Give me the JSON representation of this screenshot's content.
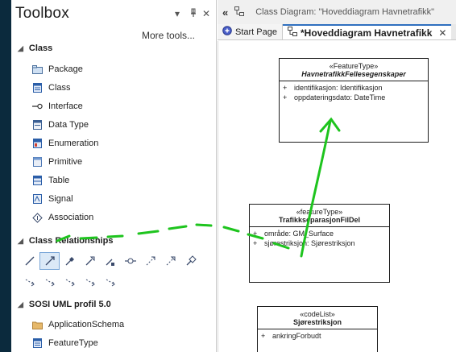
{
  "toolbox": {
    "title": "Toolbox",
    "pin_glyph": "▾",
    "dock_glyph": "ᵽ",
    "close_glyph": "✕",
    "more_tools": "More tools...",
    "sections": [
      {
        "label": "Class",
        "items": [
          {
            "label": "Package",
            "icon": "package-icon"
          },
          {
            "label": "Class",
            "icon": "class-icon"
          },
          {
            "label": "Interface",
            "icon": "interface-icon"
          },
          {
            "label": "Data Type",
            "icon": "data-type-icon"
          },
          {
            "label": "Enumeration",
            "icon": "enumeration-icon"
          },
          {
            "label": "Primitive",
            "icon": "primitive-icon"
          },
          {
            "label": "Table",
            "icon": "table-icon"
          },
          {
            "label": "Signal",
            "icon": "signal-icon"
          },
          {
            "label": "Association",
            "icon": "association-icon"
          }
        ]
      },
      {
        "label": "Class Relationships"
      },
      {
        "label": "SOSI UML profil 5.0",
        "items": [
          {
            "label": "ApplicationSchema",
            "icon": "folder-icon"
          },
          {
            "label": "FeatureType",
            "icon": "feature-type-icon"
          }
        ]
      }
    ]
  },
  "editor": {
    "path_text": "Class Diagram: \"Hoveddiagram Havnetrafikk\"",
    "tabs": [
      {
        "label": "Start Page"
      },
      {
        "label": "*Hoveddiagram Havnetrafikk"
      }
    ],
    "close_glyph": "✕"
  },
  "diagram": {
    "classes": [
      {
        "stereotype": "«FeatureType»",
        "name": "HavnetrafikkFellesegenskaper",
        "attributes": [
          {
            "vis": "+",
            "text": "identifikasjon: Identifikasjon"
          },
          {
            "vis": "+",
            "text": "oppdateringsdato: DateTime"
          }
        ]
      },
      {
        "stereotype": "«featureType»",
        "name": "TrafikkseparasjonFilDel",
        "attributes": [
          {
            "vis": "+",
            "text": "område: GM_Surface"
          },
          {
            "vis": "+",
            "text": "sjørestriksjon: Sjørestriksjon"
          }
        ]
      },
      {
        "stereotype": "«codeList»",
        "name": "Sjørestriksjon",
        "attributes": [
          {
            "vis": "+",
            "text": "ankringForbudt"
          }
        ]
      },
      {
        "stereotype": "",
        "name": "",
        "attributes": [
          {
            "vis": "+",
            "text": ""
          },
          {
            "vis": "+",
            "text": ""
          },
          {
            "vis": "+",
            "text": ""
          }
        ]
      }
    ]
  },
  "colors": {
    "accent": "#0b2a3d",
    "annotation": "#1ec41e",
    "tab_highlight": "#2f6fbf"
  }
}
